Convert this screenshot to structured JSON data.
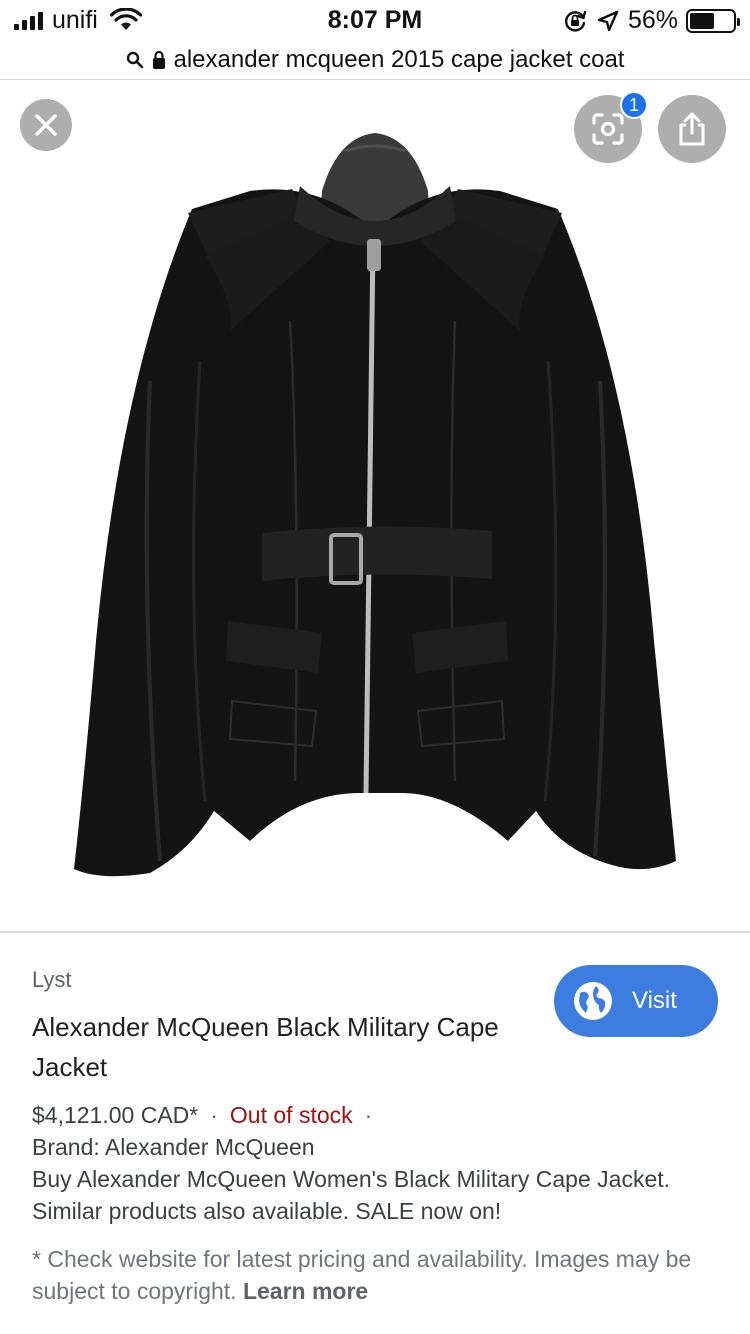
{
  "status_bar": {
    "carrier": "unifi",
    "time": "8:07 PM",
    "battery_percent": "56%",
    "battery_level": 0.56,
    "icons": [
      "signal-icon",
      "wifi-icon",
      "orientation-lock-icon",
      "location-icon",
      "battery-icon"
    ]
  },
  "url_bar": {
    "text": "alexander mcqueen 2015 cape jacket coat",
    "icons": [
      "search-icon",
      "lock-icon"
    ]
  },
  "viewer": {
    "lens_badge_count": "1",
    "icons": [
      "close-icon",
      "lens-icon",
      "share-icon"
    ]
  },
  "result": {
    "source": "Lyst",
    "title": "Alexander McQueen Black Military Cape Jacket",
    "visit_label": "Visit",
    "price": "$4,121.00 CAD*",
    "separator": "·",
    "stock_status": "Out of stock",
    "brand": "Brand: Alexander McQueen",
    "description": "Buy Alexander McQueen Women's Black Military Cape Jacket. Similar products also available. SALE now on!",
    "disclaimer": "* Check website for latest pricing and availability. Images may be subject to copyright.",
    "learn_more": "Learn more"
  },
  "colors": {
    "accent": "#3d7de0",
    "badge": "#1a73e8",
    "out_of_stock": "#a50e0e",
    "text": "#202124",
    "muted": "#70757a"
  }
}
